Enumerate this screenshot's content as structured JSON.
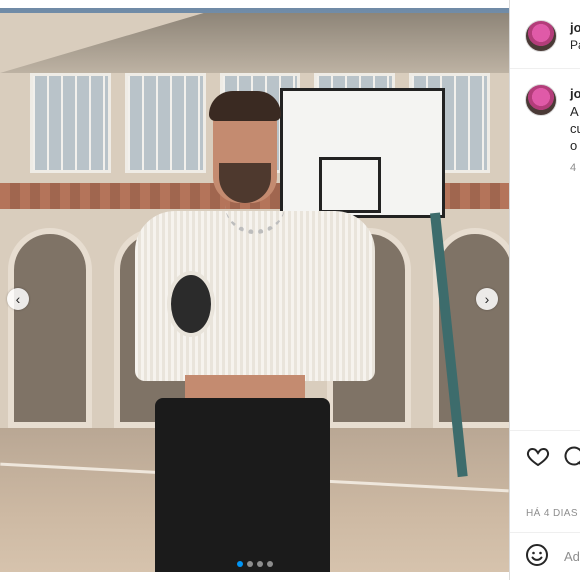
{
  "post": {
    "image_alt": "",
    "carousel": {
      "prev_icon": "chevron-left-icon",
      "next_icon": "chevron-right-icon",
      "dot_count": 4,
      "active_dot": 1
    }
  },
  "sidebar": {
    "header": {
      "username": "jo",
      "subtitle": "Pa"
    },
    "caption": {
      "username": "jo",
      "lines": [
        "A",
        "cu",
        "o"
      ],
      "time": "4"
    },
    "actions": {
      "like_icon": "heart-icon",
      "comment_icon": "comment-icon"
    },
    "date_label": "HÁ 4 DIAS",
    "add_comment": {
      "emoji_icon": "emoji-icon",
      "placeholder": "Ad"
    }
  },
  "colors": {
    "accent": "#0095f6",
    "text": "#262626",
    "muted": "#8e8e8e",
    "border": "#dbdbdb"
  }
}
